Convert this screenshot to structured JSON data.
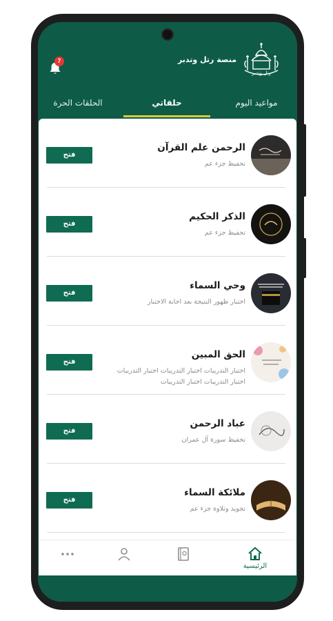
{
  "header": {
    "brand": "منصة رتل وتدبر",
    "logo_text": "رتل وتدبر",
    "notification_count": "7"
  },
  "tabs": [
    {
      "label": "مواعيد اليوم",
      "active": false
    },
    {
      "label": "حلقاتي",
      "active": true
    },
    {
      "label": "الحلقات الحرة",
      "active": false
    }
  ],
  "rings": [
    {
      "title": "الرحمن علم القرآن",
      "subtitle": "تحفيظ جزء عم",
      "button": "فتح",
      "thumb": "dark-calligraphy"
    },
    {
      "title": "الذكر الحكيم",
      "subtitle": "تحفيظ جزء عم",
      "button": "فتح",
      "thumb": "golden-calligraphy"
    },
    {
      "title": "وحي السماء",
      "subtitle": "اختبار ظهور النتيجة بعد اجابة الاختبار",
      "button": "فتح",
      "thumb": "kaaba"
    },
    {
      "title": "الحق المبين",
      "subtitle": "اختبار التدريبات  اختبار التدريبات  اختبار التدريبات  اختبار التدريبات  اختبار التدريبات",
      "button": "فتح",
      "thumb": "floral-card"
    },
    {
      "title": "عباد الرحمن",
      "subtitle": "تحفيظ سورة آل عمران",
      "button": "فتح",
      "thumb": "paper-calligraphy"
    },
    {
      "title": "ملائكة السماء",
      "subtitle": "تجويد وتلاوة جزء عم",
      "button": "فتح",
      "thumb": "open-quran"
    }
  ],
  "bottom_nav": [
    {
      "label": "الرئيسية",
      "icon": "home-icon",
      "active": true
    },
    {
      "label": "",
      "icon": "book-icon",
      "active": false
    },
    {
      "label": "",
      "icon": "profile-icon",
      "active": false
    },
    {
      "label": "",
      "icon": "more-icon",
      "active": false
    }
  ],
  "colors": {
    "brand_green": "#0e5c47",
    "button_green": "#0f6b52",
    "tab_underline": "#e0c63a",
    "badge_red": "#e53935"
  }
}
